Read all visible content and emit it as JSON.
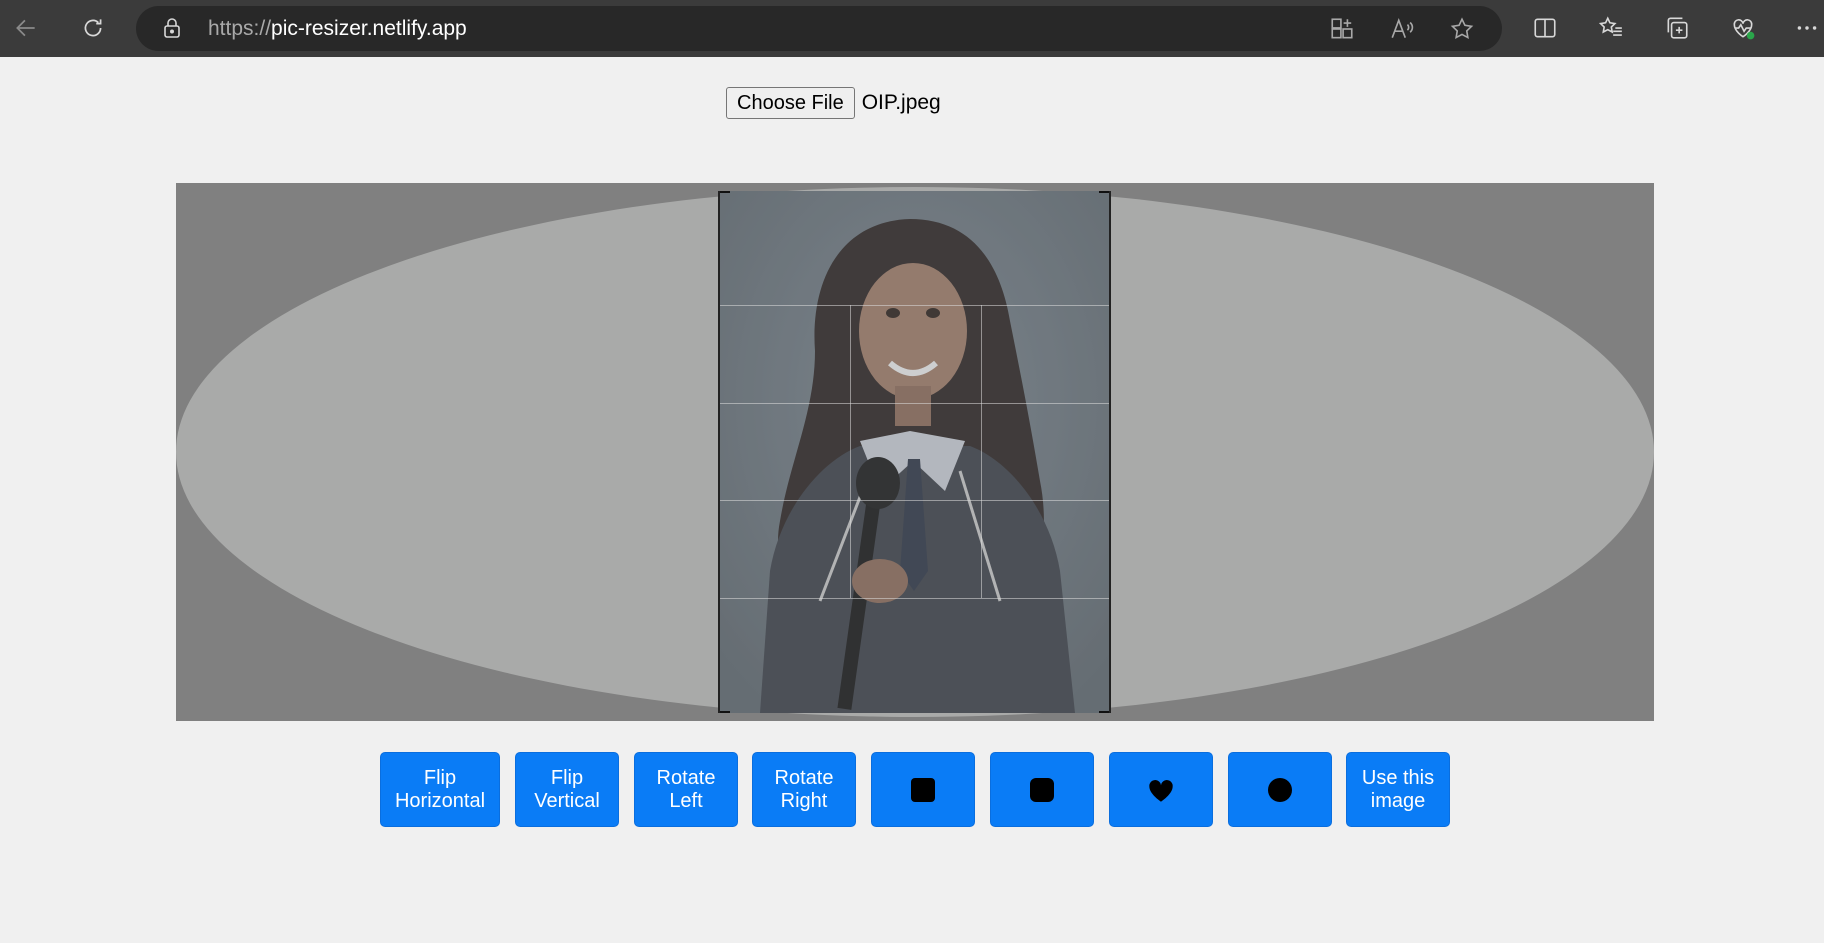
{
  "browser": {
    "url_protocol": "https://",
    "url_host": "pic-resizer.netlify.app"
  },
  "picker": {
    "choose_label": "Choose File",
    "file_name": "OIP.jpeg"
  },
  "actions": {
    "flip_horizontal": "Flip Horizontal",
    "flip_vertical": "Flip Vertical",
    "rotate_left": "Rotate Left",
    "rotate_right": "Rotate Right",
    "shape_square": "square-icon",
    "shape_rounded_square": "rounded-square-icon",
    "shape_heart": "heart-icon",
    "shape_circle": "circle-icon",
    "use_image": "Use this image"
  },
  "colors": {
    "accent": "#0a7cf6",
    "editor_background": "#808080",
    "mask_ellipse": "#a9aaa9"
  }
}
